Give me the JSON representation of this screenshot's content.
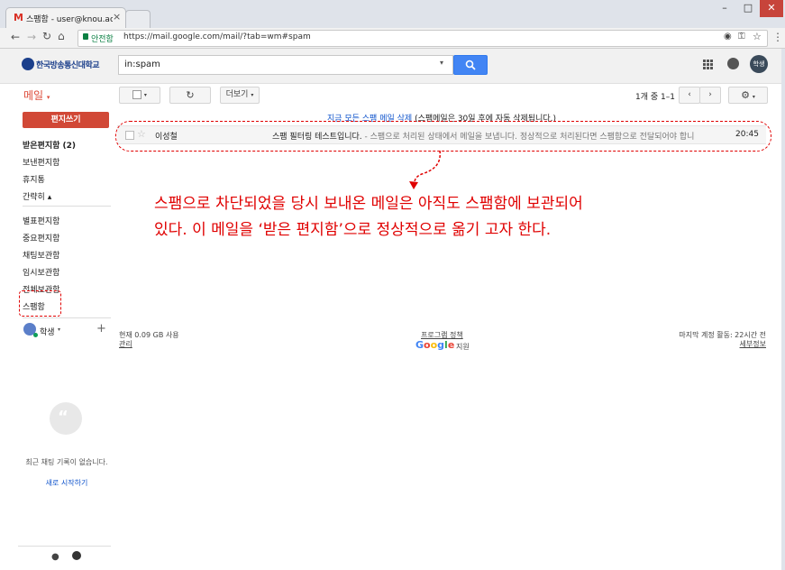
{
  "browser": {
    "tab_title": "스팸함 - user@knou.ac",
    "tab_close": "×",
    "lock_label": "안전함",
    "url": "https://mail.google.com/mail/?tab=wm#spam"
  },
  "gmail": {
    "logo_text": "한국방송통신대학교",
    "search_value": "in:spam",
    "avatar_label": "학생",
    "mail_label": "메일",
    "more_label": "더보기",
    "pagination": "1개 중 1–1",
    "compose_label": "편지쓰기",
    "spam_notice_link": "지금 모든 스팸 메일 삭제",
    "spam_notice_text": "(스팸메일은 30일 후에 자동 삭제됩니다.)",
    "sidebar": [
      {
        "label": "받은편지함 (2)",
        "bold": true
      },
      {
        "label": "보낸편지함"
      },
      {
        "label": "휴지통"
      },
      {
        "label": "간략히 ▴"
      },
      {
        "label": "별표편지함"
      },
      {
        "label": "중요편지함"
      },
      {
        "label": "채팅보관함"
      },
      {
        "label": "임시보관함"
      },
      {
        "label": "전체보관함"
      },
      {
        "label": "스팸함"
      }
    ],
    "email": {
      "sender": "이성철",
      "subject": "스팸 필터링 테스트입니다.",
      "snippet": " - 스팸으로 처리된 상태에서 메일을 보냅니다. 정상적으로 처리된다면 스팸함으로 전달되어야 합니",
      "time": "20:45"
    },
    "footer": {
      "usage": "현재 0.09 GB 사용",
      "manage": "관리",
      "program_policy": "프로그램 정책",
      "powered_by": "지원",
      "last_activity": "마지막 계정 활동: 22시간 전",
      "details": "세부정보"
    },
    "user_label": "학생",
    "hangouts": {
      "empty_text": "최근 채팅 기록이 없습니다.",
      "start_link": "새로 시작하기"
    }
  },
  "annotation": {
    "line1": "스팸으로 차단되었을 당시 보내온 메일은 아직도 스팸함에  보관되어",
    "line2": "있다. 이 메일을 ‘받은 편지함’으로 정상적으로 옮기  고자 한다."
  },
  "colors": {
    "annotation_red": "#e00000",
    "gmail_red": "#dd4b39",
    "link_blue": "#1155cc",
    "search_blue": "#4285f4"
  }
}
